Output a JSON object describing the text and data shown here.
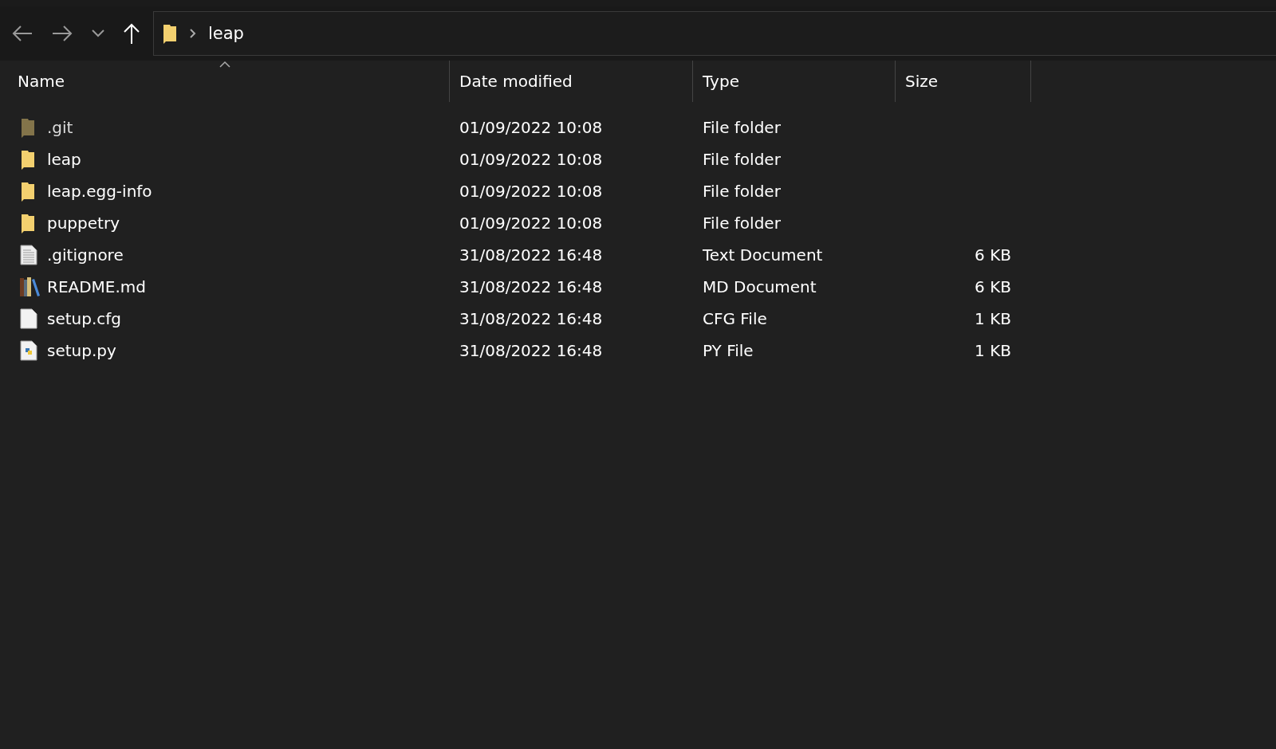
{
  "address_bar": {
    "path": [
      "leap"
    ]
  },
  "columns": [
    {
      "label": "Name",
      "sorted": true
    },
    {
      "label": "Date modified",
      "sorted": false
    },
    {
      "label": "Type",
      "sorted": false
    },
    {
      "label": "Size",
      "sorted": false
    }
  ],
  "files": [
    {
      "kind": "folder",
      "hidden": true,
      "name": ".git",
      "date": "01/09/2022 10:08",
      "type": "File folder"
    },
    {
      "kind": "folder",
      "hidden": false,
      "name": "leap",
      "date": "01/09/2022 10:08",
      "type": "File folder"
    },
    {
      "kind": "folder",
      "hidden": false,
      "name": "leap.egg-info",
      "date": "01/09/2022 10:08",
      "type": "File folder"
    },
    {
      "kind": "folder",
      "hidden": false,
      "name": "puppetry",
      "date": "01/09/2022 10:08",
      "type": "File folder"
    },
    {
      "kind": "text",
      "hidden": false,
      "name": ".gitignore",
      "date": "31/08/2022 16:48",
      "type": "Text Document",
      "size": "6 KB"
    },
    {
      "kind": "books",
      "hidden": false,
      "name": "README.md",
      "date": "31/08/2022 16:48",
      "type": "MD Document",
      "size": "6 KB"
    },
    {
      "kind": "blank",
      "hidden": false,
      "name": "setup.cfg",
      "date": "31/08/2022 16:48",
      "type": "CFG File",
      "size": "1 KB"
    },
    {
      "kind": "python",
      "hidden": false,
      "name": "setup.py",
      "date": "31/08/2022 16:48",
      "type": "PY File",
      "size": "1 KB"
    }
  ]
}
